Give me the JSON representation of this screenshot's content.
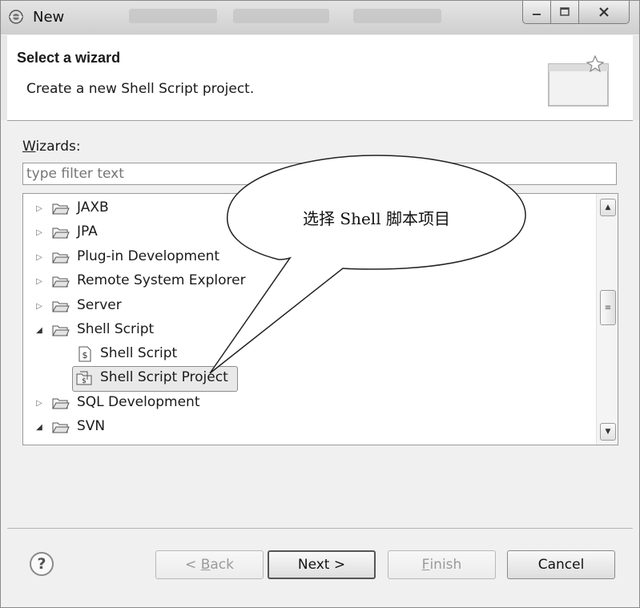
{
  "window": {
    "title": "New"
  },
  "header": {
    "title": "Select a wizard",
    "description": "Create a new Shell Script project."
  },
  "filter": {
    "label": "Wizards:",
    "label_mnemonic": "W",
    "label_rest": "izards:",
    "placeholder": "type filter text"
  },
  "tree": {
    "items": [
      {
        "label": "JAXB",
        "expanded": false,
        "level": 0,
        "type": "folder"
      },
      {
        "label": "JPA",
        "expanded": false,
        "level": 0,
        "type": "folder"
      },
      {
        "label": "Plug-in Development",
        "expanded": false,
        "level": 0,
        "type": "folder"
      },
      {
        "label": "Remote System Explorer",
        "expanded": false,
        "level": 0,
        "type": "folder"
      },
      {
        "label": "Server",
        "expanded": false,
        "level": 0,
        "type": "folder"
      },
      {
        "label": "Shell Script",
        "expanded": true,
        "level": 0,
        "type": "folder"
      },
      {
        "label": "Shell Script",
        "level": 1,
        "type": "shell-script-file"
      },
      {
        "label": "Shell Script Project",
        "level": 1,
        "type": "shell-script-project",
        "selected": true
      },
      {
        "label": "SQL Development",
        "expanded": false,
        "level": 0,
        "type": "folder"
      },
      {
        "label": "SVN",
        "expanded": true,
        "level": 0,
        "type": "folder"
      }
    ]
  },
  "callout": {
    "text": "选择 Shell 脚本项目"
  },
  "buttons": {
    "back": {
      "label_prefix": "< ",
      "mnemonic": "B",
      "label_rest": "ack",
      "enabled": false
    },
    "next": {
      "label": "Next >",
      "enabled": true
    },
    "finish": {
      "mnemonic": "F",
      "label_rest": "inish",
      "enabled": false
    },
    "cancel": {
      "label": "Cancel",
      "enabled": true
    }
  },
  "help": {
    "symbol": "?"
  }
}
